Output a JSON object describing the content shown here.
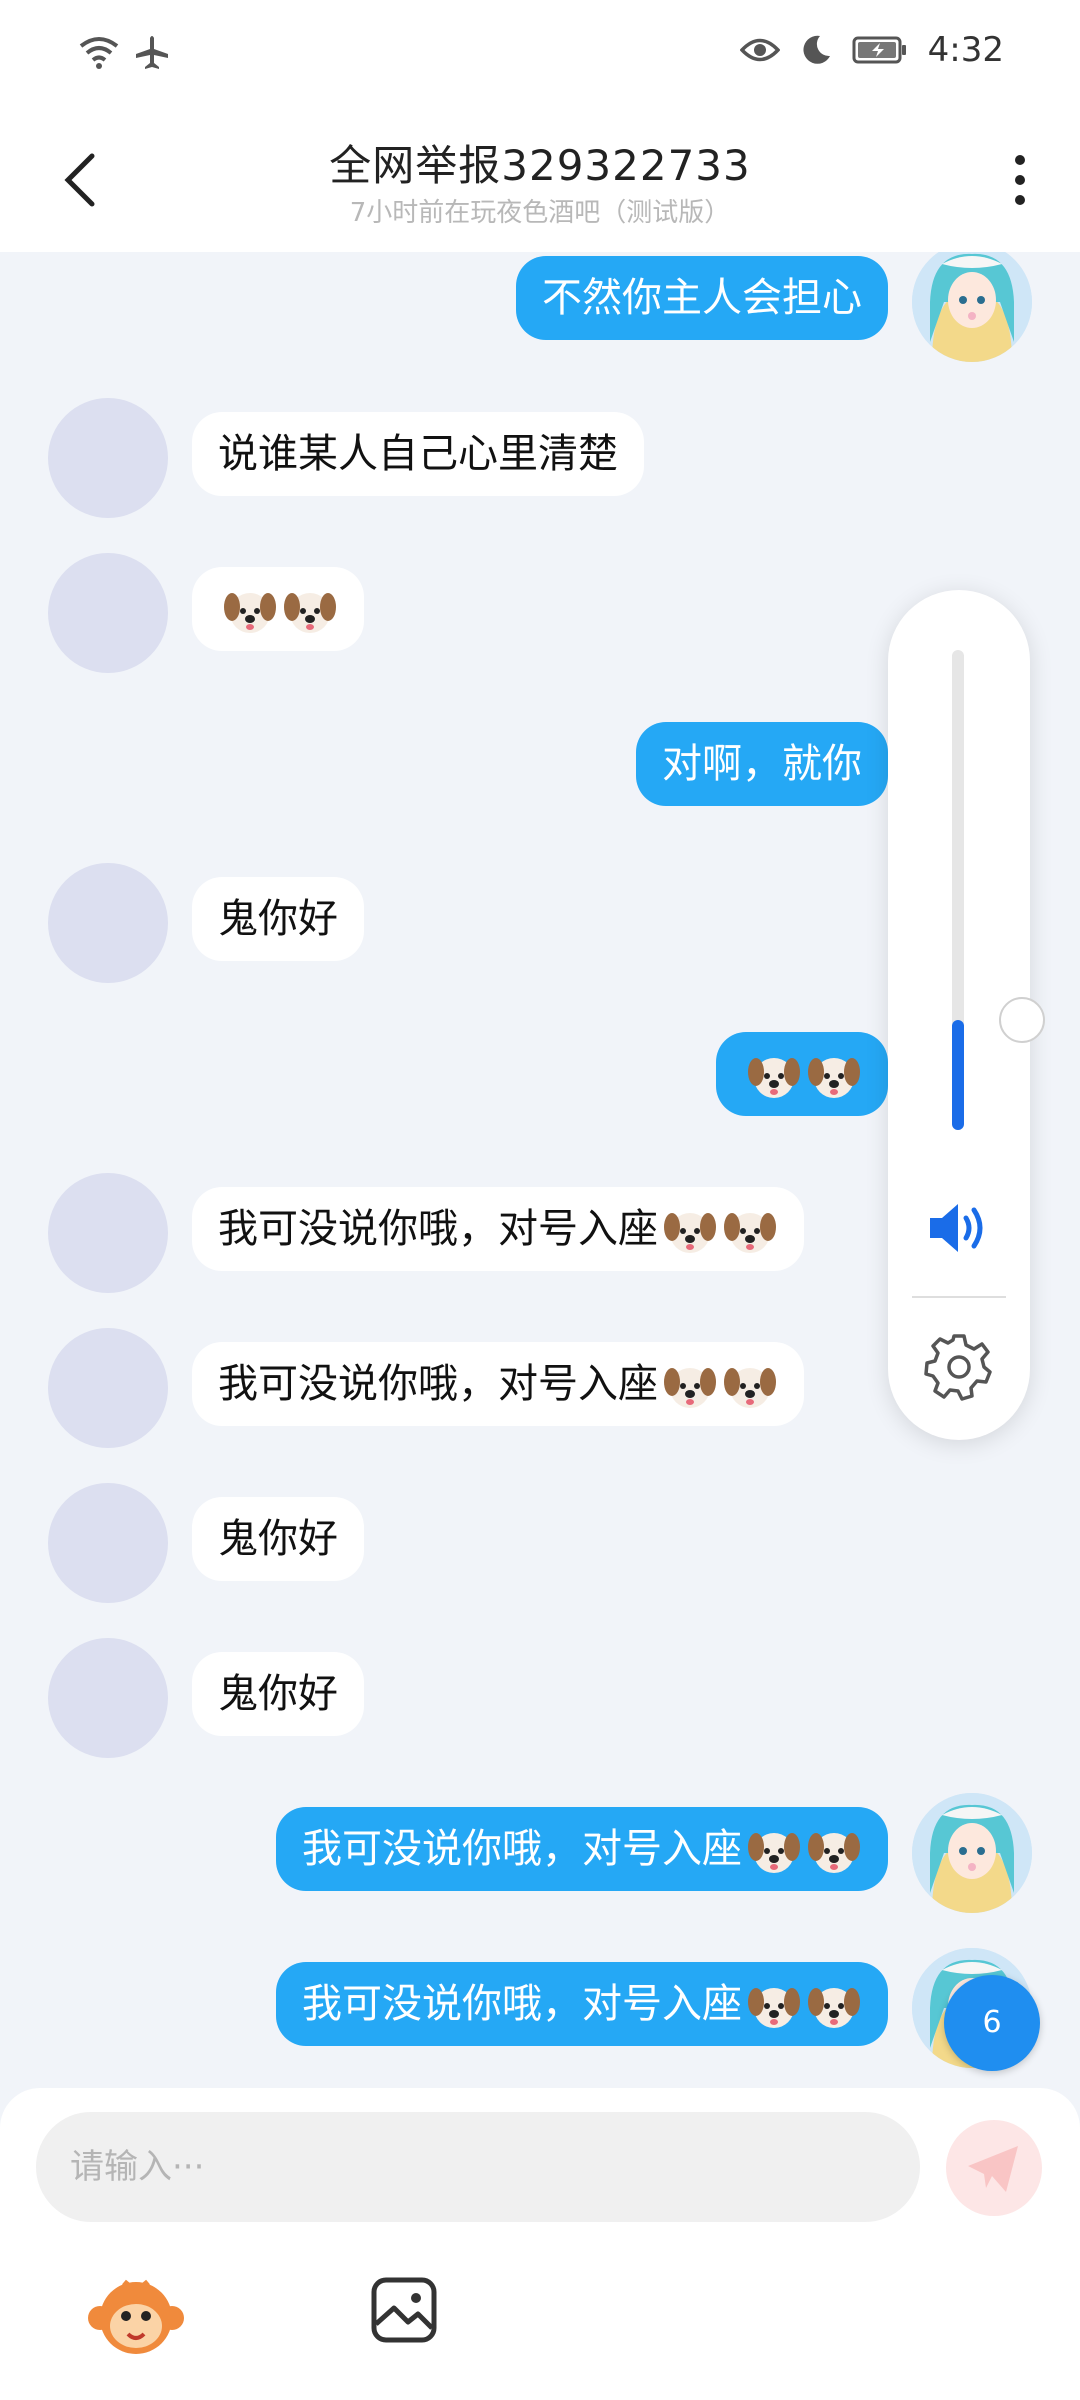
{
  "status_bar": {
    "time": "4:32",
    "icons": [
      "wifi-icon",
      "airplane-icon",
      "eye-icon",
      "moon-icon",
      "battery-icon"
    ]
  },
  "header": {
    "title": "全网举报329322733",
    "subtitle": "7小时前在玩夜色酒吧（测试版）",
    "back_icon": "chevron-left-icon",
    "more_icon": "more-vertical-icon"
  },
  "messages": [
    {
      "side": "out",
      "text": "不然你主人会担心",
      "dogs": 0
    },
    {
      "side": "in",
      "text": "说谁某人自己心里清楚",
      "dogs": 0
    },
    {
      "side": "in",
      "text": "",
      "dogs": 2
    },
    {
      "side": "out",
      "text": "对啊，就你",
      "dogs": 0
    },
    {
      "side": "in",
      "text": "鬼你好",
      "dogs": 0
    },
    {
      "side": "out",
      "text": "",
      "dogs": 2
    },
    {
      "side": "in",
      "text": "我可没说你哦，对号入座",
      "dogs": 2
    },
    {
      "side": "in",
      "text": "我可没说你哦，对号入座",
      "dogs": 2
    },
    {
      "side": "in",
      "text": "鬼你好",
      "dogs": 0
    },
    {
      "side": "in",
      "text": "鬼你好",
      "dogs": 0
    },
    {
      "side": "out",
      "text": "我可没说你哦，对号入座",
      "dogs": 2
    },
    {
      "side": "out",
      "text": "我可没说你哦，对号入座",
      "dogs": 2
    }
  ],
  "volume_panel": {
    "level_fraction": 0.23,
    "speaker_icon": "speaker-icon",
    "settings_icon": "gear-icon",
    "accent_color": "#1a6ce8"
  },
  "unread_badge": "6",
  "input": {
    "placeholder": "请输入···",
    "send_icon": "send-icon"
  },
  "toolbar": {
    "items": [
      "monkey-sticker-icon",
      "image-icon"
    ]
  },
  "colors": {
    "outgoing_bubble": "#25a8f5",
    "incoming_bubble": "#ffffff",
    "background": "#f1f4f9"
  }
}
